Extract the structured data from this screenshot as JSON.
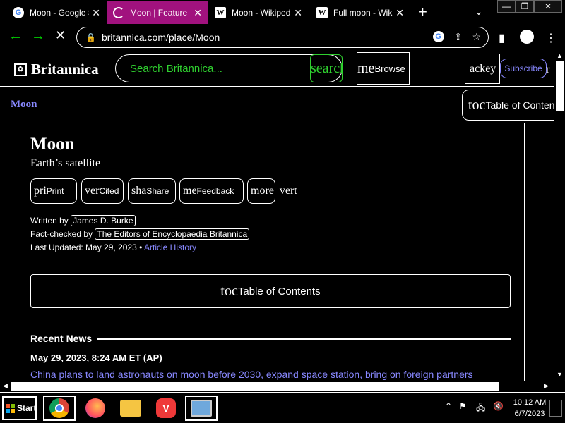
{
  "browser": {
    "tabs": [
      {
        "title": "Moon - Google S",
        "favicon": "google-icon",
        "active": false
      },
      {
        "title": "Moon | Feature",
        "favicon": "loading-spinner-icon",
        "active": true
      },
      {
        "title": "Moon - Wikiped",
        "favicon": "wikipedia-icon",
        "active": false
      },
      {
        "title": "Full moon - Wiki",
        "favicon": "wikipedia-icon",
        "active": false
      }
    ],
    "url": "britannica.com/place/Moon",
    "accent": "#a1127e"
  },
  "site": {
    "logo_text": "Britannica",
    "search_placeholder": "Search Britannica...",
    "search_button_icon": "search",
    "browse_icon": "me",
    "browse_label": "Browse",
    "login_icon": "ac",
    "login_label": "key",
    "subscribe_label": "Subscribe",
    "header_overflow": "r",
    "subnav_title": "Moon",
    "subnav_toc_icon": "toc",
    "subnav_toc_label": "Table of Contents"
  },
  "article": {
    "title": "Moon",
    "subtitle": "Earth’s satellite",
    "actions": [
      {
        "icon": "pri",
        "label": "Print"
      },
      {
        "icon": "ver",
        "label": "Cited"
      },
      {
        "icon": "sha",
        "label": "Share"
      },
      {
        "icon": "me",
        "label": "Feedback"
      },
      {
        "icon": "more_vert",
        "label": ""
      }
    ],
    "written_by_label": "Written by",
    "author": "James D. Burke",
    "fact_checked_label": "Fact-checked by",
    "fact_checker": "The Editors of Encyclopaedia Britannica",
    "last_updated": "Last Updated: May 29, 2023 •",
    "article_history": "Article History",
    "toc_icon": "toc",
    "toc_label": "Table of Contents",
    "recent_news_label": "Recent News",
    "news_date": "May 29, 2023, 8:24 AM ET (AP)",
    "news_headline": "China plans to land astronauts on moon before 2030, expand space station, bring on foreign partners",
    "link_color": "#8888ff",
    "search_color": "#2fd02f"
  },
  "taskbar": {
    "start_label": "Start",
    "time": "10:12 AM",
    "date": "6/7/2023"
  }
}
